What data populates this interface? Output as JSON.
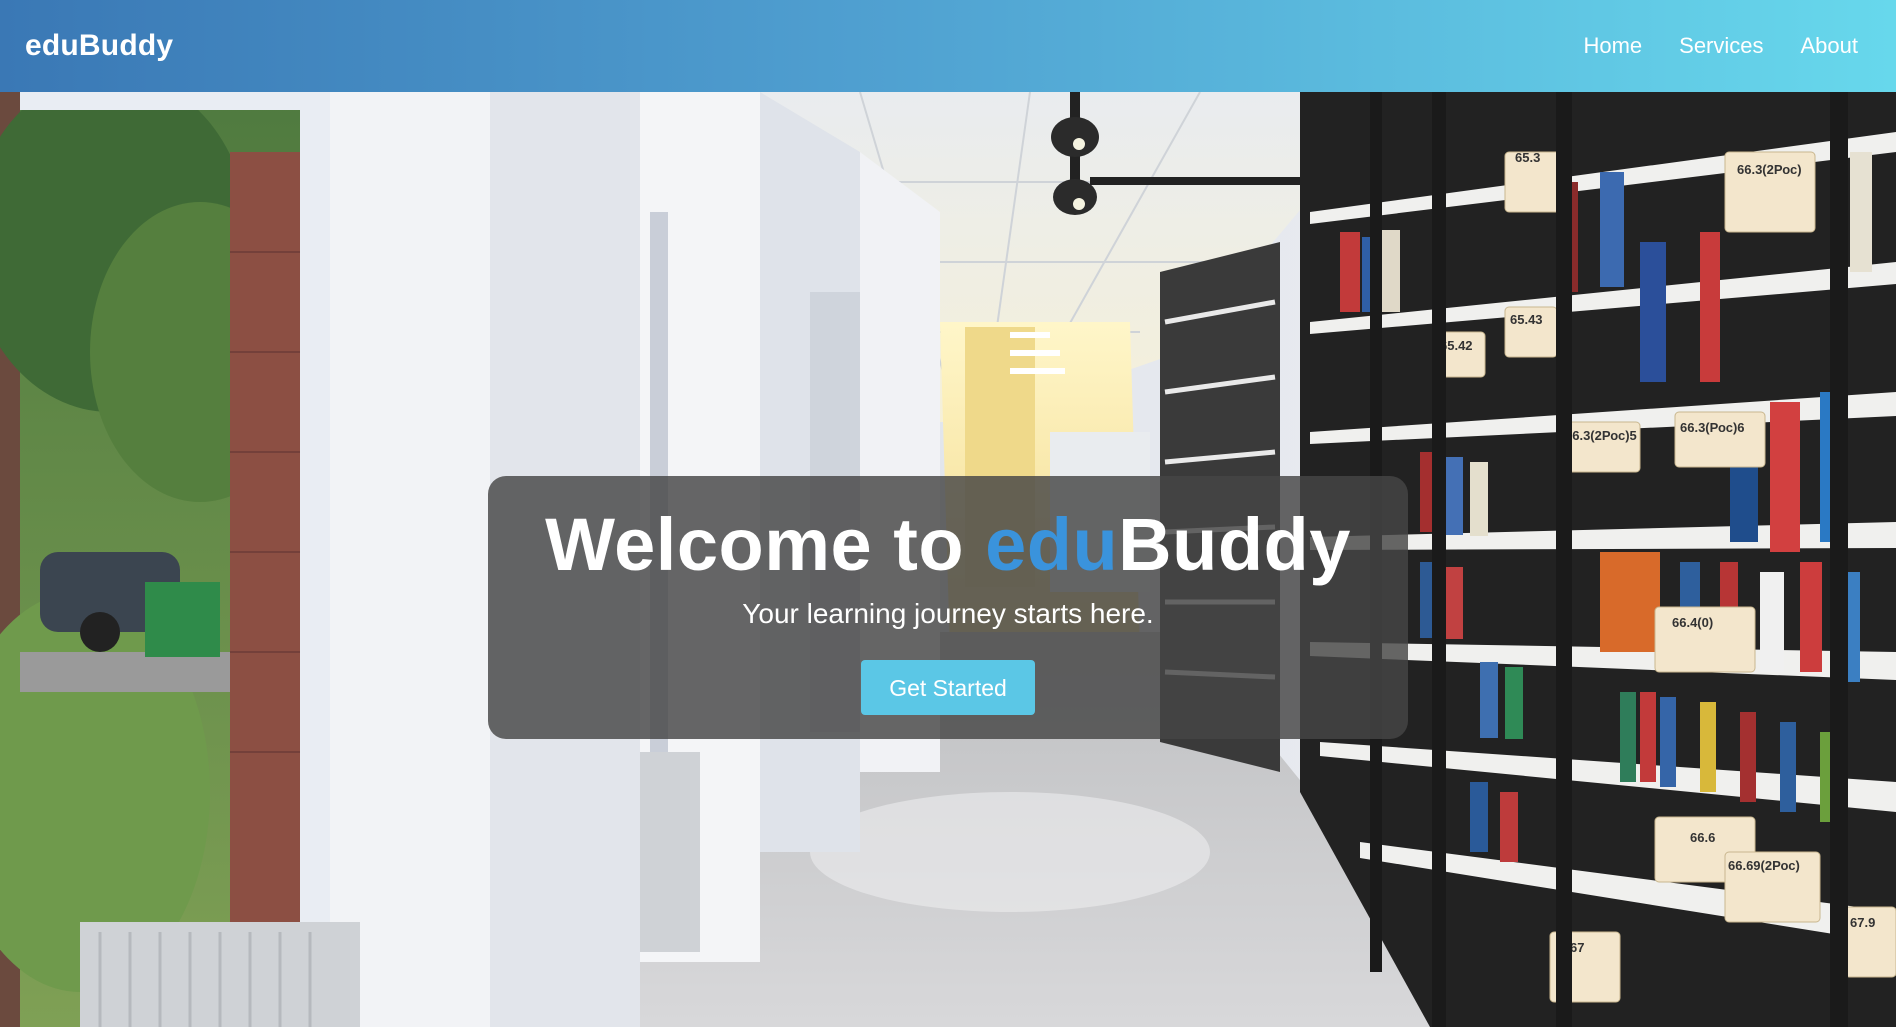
{
  "navbar": {
    "brand": "eduBuddy",
    "links": [
      {
        "label": "Home"
      },
      {
        "label": "Services"
      },
      {
        "label": "About"
      }
    ]
  },
  "hero": {
    "title_prefix": "Welcome to ",
    "title_accent": "edu",
    "title_suffix": "Buddy",
    "subtitle": "Your learning journey starts here.",
    "cta_label": "Get Started"
  },
  "shelf_labels": [
    "65.3",
    "65.43",
    "65.42",
    "66.3(2Рос)",
    "66.3(2Рос)5",
    "66.3(Рос)6",
    "66.4(0)",
    "66.6",
    "66.69(2Рос)",
    "67",
    "67.9"
  ],
  "colors": {
    "accent": "#3a93dc",
    "cta": "#5bc7e6",
    "nav_start": "#3a78b5",
    "nav_end": "#67d8ec"
  }
}
